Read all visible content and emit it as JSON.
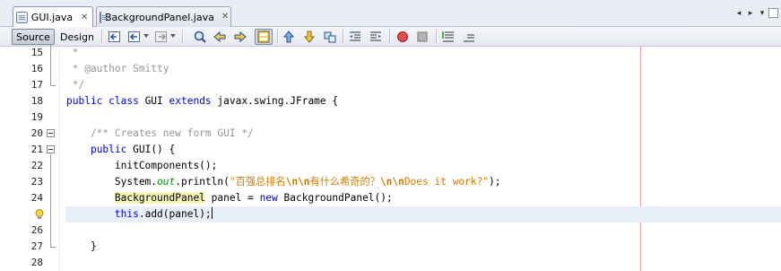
{
  "tabs": [
    {
      "label": "GUI.java",
      "active": true
    },
    {
      "label": "BackgroundPanel.java",
      "active": false
    }
  ],
  "toolbar": {
    "source_label": "Source",
    "design_label": "Design",
    "icons": [
      "last-edit-icon",
      "back-icon",
      "forward-icon",
      "find-icon",
      "find-previous-icon",
      "find-next-icon",
      "toggle-highlight-icon",
      "toggle-bookmark-icon",
      "previous-bookmark-icon",
      "next-bookmark-icon",
      "shift-left-icon",
      "shift-right-icon",
      "record-macro-icon",
      "stop-macro-icon",
      "comment-icon",
      "uncomment-icon"
    ]
  },
  "editor": {
    "lines": [
      {
        "n": "15",
        "html_parts": [
          {
            "t": " *",
            "c": "cmt"
          }
        ]
      },
      {
        "n": "16",
        "html_parts": [
          {
            "t": " * @author Smitty",
            "c": "cmt"
          }
        ]
      },
      {
        "n": "17",
        "html_parts": [
          {
            "t": " */",
            "c": "cmt"
          }
        ]
      },
      {
        "n": "18",
        "html_parts": [
          {
            "t": "public class ",
            "c": "kw"
          },
          {
            "t": "GUI ",
            "c": ""
          },
          {
            "t": "extends ",
            "c": "kw"
          },
          {
            "t": "javax.swing.JFrame {",
            "c": ""
          }
        ]
      },
      {
        "n": "19",
        "html_parts": []
      },
      {
        "n": "20",
        "html_parts": [
          {
            "t": "    /** Creates new form GUI */",
            "c": "cmt"
          }
        ]
      },
      {
        "n": "21",
        "html_parts": [
          {
            "t": "    ",
            "c": ""
          },
          {
            "t": "public ",
            "c": "kw"
          },
          {
            "t": "GUI() {",
            "c": ""
          }
        ]
      },
      {
        "n": "22",
        "html_parts": [
          {
            "t": "        initComponents();",
            "c": ""
          }
        ]
      },
      {
        "n": "23",
        "html_parts": [
          {
            "t": "        System.",
            "c": ""
          },
          {
            "t": "out",
            "c": "fld"
          },
          {
            "t": ".println(",
            "c": ""
          },
          {
            "t": "\"百强总排名",
            "c": "str"
          },
          {
            "t": "\\n\\n",
            "c": "esc"
          },
          {
            "t": "有什么希奇的？",
            "c": "str"
          },
          {
            "t": "\\n\\n",
            "c": "esc"
          },
          {
            "t": "Does it work?\"",
            "c": "str"
          },
          {
            "t": ");",
            "c": ""
          }
        ]
      },
      {
        "n": "24",
        "html_parts": [
          {
            "t": "        ",
            "c": ""
          },
          {
            "t": "BackgroundPanel",
            "c": "hl"
          },
          {
            "t": " panel = ",
            "c": ""
          },
          {
            "t": "new ",
            "c": "kw"
          },
          {
            "t": "BackgroundPanel();",
            "c": ""
          }
        ]
      },
      {
        "n": "",
        "html_parts": [
          {
            "t": "        ",
            "c": ""
          },
          {
            "t": "this",
            "c": "kw"
          },
          {
            "t": ".add(panel);",
            "c": ""
          }
        ]
      },
      {
        "n": "26",
        "html_parts": []
      },
      {
        "n": "27",
        "html_parts": [
          {
            "t": "    }",
            "c": ""
          }
        ]
      },
      {
        "n": "28",
        "html_parts": []
      }
    ]
  }
}
